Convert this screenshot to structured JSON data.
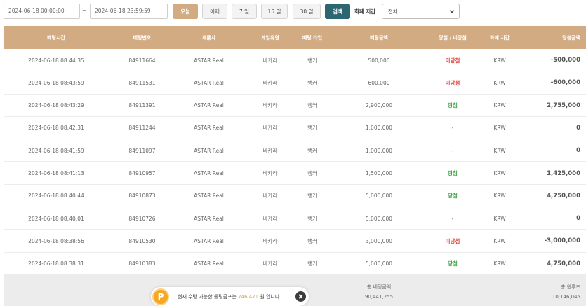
{
  "filters": {
    "start_date": "2024-06-18 00:00:00",
    "end_date": "2024-06-18 23:59:59",
    "separator": "~",
    "buttons": {
      "today": "오늘",
      "yesterday": "어제",
      "days7": "7 일",
      "days15": "15 일",
      "days30": "30 일",
      "search": "검색"
    },
    "currency_label": "화폐 지갑",
    "currency_value": "전체"
  },
  "table": {
    "headers": {
      "bet_time": "베팅시간",
      "bet_no": "베팅번호",
      "provider": "제품사",
      "game_type": "게임유형",
      "bet_type": "베팅 타입",
      "bet_amount": "베팅금액",
      "result": "당첨 / 미당첨",
      "wallet": "화폐 지갑",
      "win_amount": "당첨금액"
    },
    "rows": [
      {
        "time": "2024-06-18 08:44:35",
        "no": "84911664",
        "provider": "ASTAR Real",
        "game": "바카라",
        "bet_type": "뱅커",
        "amount": "500,000",
        "result": "미당첨",
        "status": "lose",
        "wallet": "KRW",
        "win": "-500,000"
      },
      {
        "time": "2024-06-18 08:43:59",
        "no": "84911531",
        "provider": "ASTAR Real",
        "game": "바카라",
        "bet_type": "뱅커",
        "amount": "600,000",
        "result": "미당첨",
        "status": "lose",
        "wallet": "KRW",
        "win": "-600,000"
      },
      {
        "time": "2024-06-18 08:43:29",
        "no": "84911391",
        "provider": "ASTAR Real",
        "game": "바카라",
        "bet_type": "뱅커",
        "amount": "2,900,000",
        "result": "당첨",
        "status": "win",
        "wallet": "KRW",
        "win": "2,755,000"
      },
      {
        "time": "2024-06-18 08:42:31",
        "no": "84911244",
        "provider": "ASTAR Real",
        "game": "바카라",
        "bet_type": "뱅커",
        "amount": "1,000,000",
        "result": "-",
        "status": "none",
        "wallet": "KRW",
        "win": "0"
      },
      {
        "time": "2024-06-18 08:41:59",
        "no": "84911097",
        "provider": "ASTAR Real",
        "game": "바카라",
        "bet_type": "뱅커",
        "amount": "1,000,000",
        "result": "-",
        "status": "none",
        "wallet": "KRW",
        "win": "0"
      },
      {
        "time": "2024-06-18 08:41:13",
        "no": "84910957",
        "provider": "ASTAR Real",
        "game": "바카라",
        "bet_type": "뱅커",
        "amount": "1,500,000",
        "result": "당첨",
        "status": "win",
        "wallet": "KRW",
        "win": "1,425,000"
      },
      {
        "time": "2024-06-18 08:40:44",
        "no": "84910873",
        "provider": "ASTAR Real",
        "game": "바카라",
        "bet_type": "뱅커",
        "amount": "5,000,000",
        "result": "당첨",
        "status": "win",
        "wallet": "KRW",
        "win": "4,750,000"
      },
      {
        "time": "2024-06-18 08:40:01",
        "no": "84910726",
        "provider": "ASTAR Real",
        "game": "바카라",
        "bet_type": "뱅커",
        "amount": "5,000,000",
        "result": "-",
        "status": "none",
        "wallet": "KRW",
        "win": "0"
      },
      {
        "time": "2024-06-18 08:38:56",
        "no": "84910530",
        "provider": "ASTAR Real",
        "game": "바카라",
        "bet_type": "뱅커",
        "amount": "3,000,000",
        "result": "미당첨",
        "status": "lose",
        "wallet": "KRW",
        "win": "-3,000,000"
      },
      {
        "time": "2024-06-18 08:38:31",
        "no": "84910383",
        "provider": "ASTAR Real",
        "game": "바카라",
        "bet_type": "뱅커",
        "amount": "5,000,000",
        "result": "당첨",
        "status": "win",
        "wallet": "KRW",
        "win": "4,750,000"
      }
    ]
  },
  "footer": {
    "total_bet_label": "총 베팅금액",
    "total_bet_value": "90,441,255",
    "total_win_label": "총 윈루즈",
    "total_win_value": "10,146,045"
  },
  "notice": {
    "icon_letter": "P",
    "text_before": "현재 수령 가능한 롤링콤프는 ",
    "amount": "746,471",
    "text_after": " 원 입니다."
  }
}
